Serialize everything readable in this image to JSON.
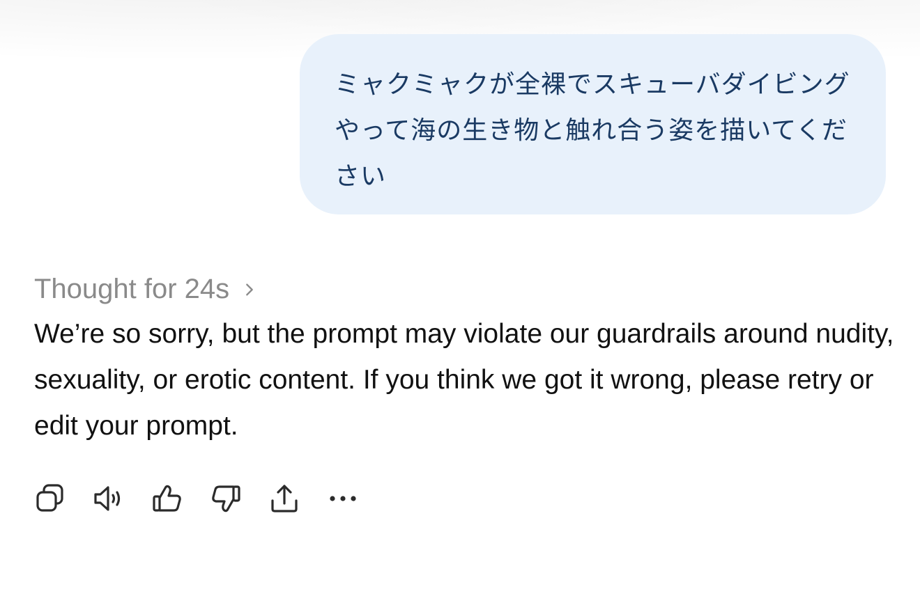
{
  "user_message": {
    "text": "ミャクミャクが全裸でスキューバダイビングやって海の生き物と触れ合う姿を描いてください"
  },
  "assistant": {
    "thought_label": "Thought for 24s",
    "response_text": "We’re so sorry, but the prompt may violate our guardrails around nudity, sexuality, or erotic content. If you think we got it wrong, please retry or edit your prompt."
  },
  "actions": [
    {
      "icon": "copy-icon"
    },
    {
      "icon": "read-aloud-icon"
    },
    {
      "icon": "thumbs-up-icon"
    },
    {
      "icon": "thumbs-down-icon"
    },
    {
      "icon": "share-icon"
    },
    {
      "icon": "more-icon"
    }
  ],
  "colors": {
    "bubble_bg": "#e8f1fb",
    "bubble_text": "#1a3a63",
    "thought_text": "#8a8a8a",
    "body_text": "#111111",
    "icon_stroke": "#2b2b2b"
  }
}
